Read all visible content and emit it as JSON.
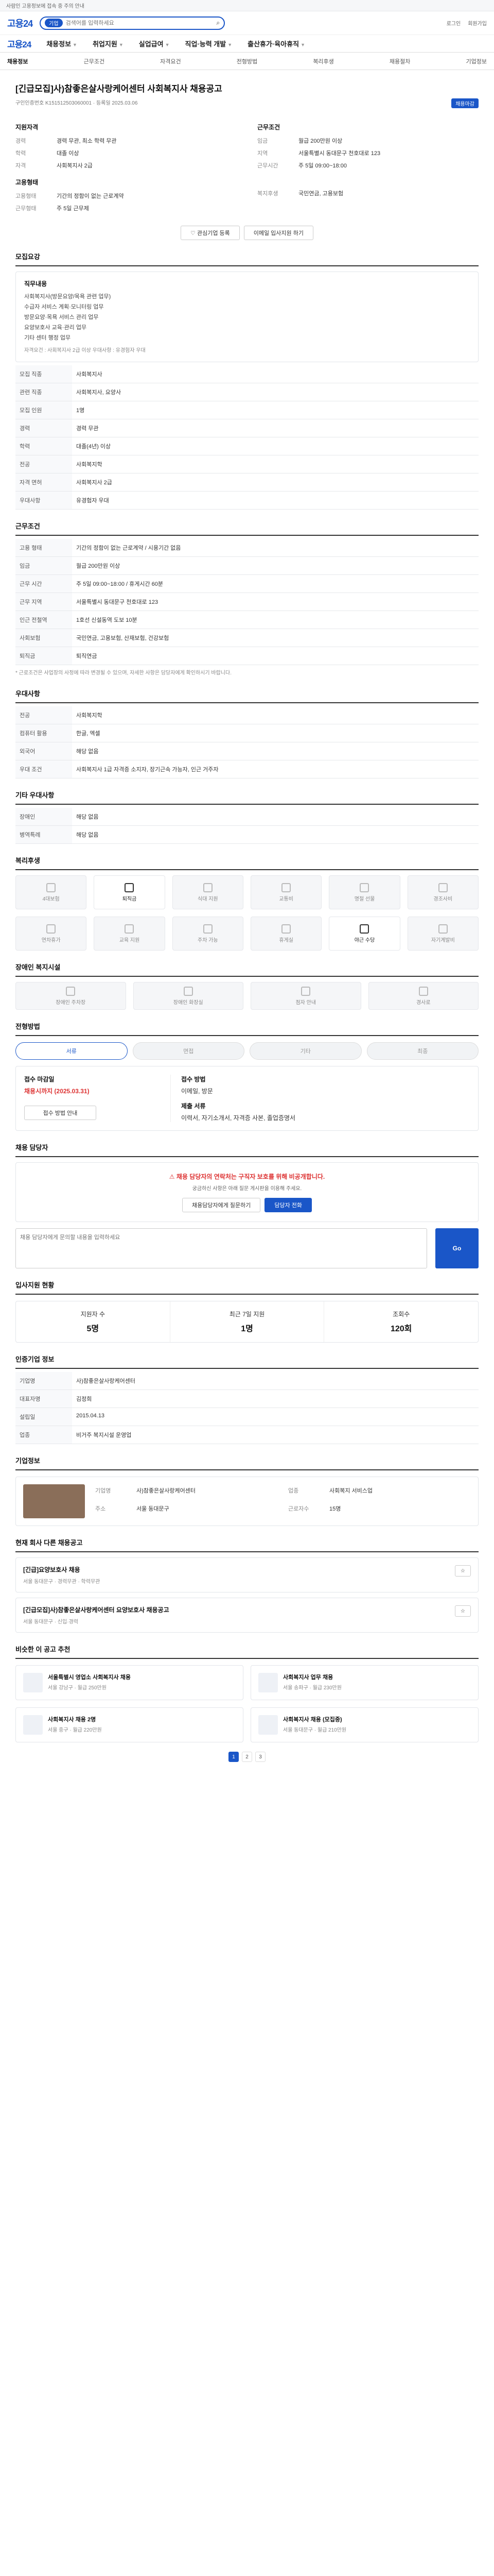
{
  "notice": "사람인 고용정보에 접속 중 주의 안내",
  "header": {
    "logo": "고용24",
    "search_placeholder": "검색어를 입력하세요",
    "search_chip": "기업",
    "login": "로그인",
    "join": "회원가입"
  },
  "gnb": {
    "items": [
      "채용정보",
      "취업지원",
      "실업급여",
      "직업·능력 개발",
      "출산휴가·육아휴직"
    ]
  },
  "tabs": [
    "채용정보",
    "근무조건",
    "자격요건",
    "전형방법",
    "복리후생",
    "채용절차",
    "기업정보"
  ],
  "job": {
    "title": "[긴급모집]사)참좋은살사랑케어센터 사회복지사 채용공고",
    "id": "구인인증번호 K151512503060001",
    "date": "등록일 2025.03.06",
    "status": "채용마감"
  },
  "summary": {
    "left_h": "지원자격",
    "left": [
      [
        "경력",
        "경력 무관, 최소 학력 무관"
      ],
      [
        "학력",
        "대졸 이상"
      ],
      [
        "자격",
        "사회복지사 2급"
      ]
    ],
    "right_h": "근무조건",
    "right": [
      [
        "임금",
        "월급 200만원 이상"
      ],
      [
        "지역",
        "서울특별시 동대문구 천호대로 123"
      ],
      [
        "근무시간",
        "주 5일 09:00~18:00"
      ]
    ],
    "bottom_h": "고용형태",
    "bottom": [
      [
        "고용형태",
        "기간의 정함이 없는 근로계약"
      ],
      [
        "근무형태",
        "주 5일 근무제"
      ]
    ],
    "bottom_r": [
      [
        "복지후생",
        "국민연금, 고용보험"
      ]
    ]
  },
  "btns": {
    "interest": "관심기업 등록",
    "apply": "이메일 입사지원 하기"
  },
  "jobinfo": {
    "title": "모집요강",
    "h": "직무내용",
    "items": [
      "사회복지사(방문요양/목욕 관련 업무)",
      "수급자 서비스 계획·모니터링 업무",
      "방문요양·목욕 서비스 관리 업무",
      "요양보호사 교육·관리 업무",
      "기타 센터 행정 업무"
    ],
    "note": "자격요건 : 사회복지사 2급 이상 우대사항 : 유경험자 우대"
  },
  "table1": [
    [
      "모집 직종",
      "사회복지사"
    ],
    [
      "관련 직종",
      "사회복지사, 요양사"
    ],
    [
      "모집 인원",
      "1명"
    ],
    [
      "경력",
      "경력 무관"
    ],
    [
      "학력",
      "대졸(4년) 이상"
    ],
    [
      "전공",
      "사회복지학"
    ],
    [
      "자격 면허",
      "사회복지사 2급"
    ],
    [
      "우대사항",
      "유경험자 우대"
    ]
  ],
  "work": {
    "title": "근무조건",
    "rows": [
      [
        "고용 형태",
        "기간의 정함이 없는 근로계약 / 시용기간 없음"
      ],
      [
        "임금",
        "월급 200만원 이상"
      ],
      [
        "근무 시간",
        "주 5일 09:00~18:00 / 휴게시간 60분"
      ],
      [
        "근무 지역",
        "서울특별시 동대문구 천호대로 123"
      ],
      [
        "인근 전철역",
        "1호선 신설동역 도보 10분"
      ],
      [
        "사회보험",
        "국민연금, 고용보험, 산재보험, 건강보험"
      ],
      [
        "퇴직금",
        "퇴직연금"
      ]
    ],
    "note": "* 근로조건은 사업장의 사정에 따라 변경될 수 있으며, 자세한 사항은 담당자에게 확인하시기 바랍니다."
  },
  "qual": {
    "title": "우대사항",
    "rows": [
      [
        "전공",
        "사회복지학"
      ],
      [
        "컴퓨터 활용",
        "한글, 엑셀"
      ],
      [
        "외국어",
        "해당 없음"
      ],
      [
        "우대 조건",
        "사회복지사 1급 자격증 소지자, 장기근속 가능자, 인근 거주자"
      ]
    ]
  },
  "other": {
    "title": "기타 우대사항",
    "rows": [
      [
        "장애인",
        "해당 없음"
      ],
      [
        "병역특례",
        "해당 없음"
      ]
    ]
  },
  "welfare": {
    "title": "복리후생",
    "tiles": [
      "4대보험",
      "퇴직금",
      "식대 지원",
      "교통비",
      "명절 선물",
      "경조사비",
      "연차휴가",
      "교육 지원",
      "주차 가능",
      "휴게실",
      "야근 수당",
      "자기계발비"
    ],
    "active": [
      1,
      10
    ]
  },
  "disab": {
    "title": "장애인 복지시설",
    "tiles": [
      "장애인 주차장",
      "장애인 화장실",
      "점자 안내",
      "경사로"
    ]
  },
  "apply": {
    "title": "전형방법",
    "steps": [
      "서류",
      "면접",
      "기타",
      "최종"
    ],
    "active": 1,
    "l_h": "접수 마감일",
    "l_v": "채용시까지 (2025.03.31)",
    "r_h": "접수 방법",
    "r_v": "이메일, 방문",
    "r2_h": "제출 서류",
    "r2_v": "이력서, 자기소개서, 자격증 사본, 졸업증명서",
    "btn": "접수 방법 안내"
  },
  "qna": {
    "title": "채용 담당자",
    "warn_h": "채용 담당자의 연락처는 구직자 보호를 위해 비공개합니다.",
    "warn_p": "궁금하신 사항은 아래 질문 게시판을 이용해 주세요.",
    "btn1": "채용담당자에게 질문하기",
    "btn2": "담당자 전화",
    "q_placeholder": "채용 담당자에게 문의할 내용을 입력하세요",
    "q_btn": "Go"
  },
  "stats": {
    "title": "입사지원 현황",
    "items": [
      [
        "지원자 수",
        "5명"
      ],
      [
        "최근 7일 지원",
        "1명"
      ],
      [
        "조회수",
        "120회"
      ]
    ]
  },
  "recruit": {
    "title": "인증기업 정보",
    "rows": [
      [
        "기업명",
        "사)참좋은살사랑케어센터"
      ],
      [
        "대표자명",
        "김정희"
      ],
      [
        "설립일",
        "2015.04.13"
      ],
      [
        "업종",
        "비거주 복지시설 운영업"
      ]
    ]
  },
  "company": {
    "title": "기업정보",
    "rows": [
      [
        "기업명",
        "사)참좋은살사랑케어센터"
      ],
      [
        "업종",
        "사회복지 서비스업"
      ],
      [
        "주소",
        "서울 동대문구"
      ],
      [
        "근로자수",
        "15명"
      ]
    ]
  },
  "others": {
    "title": "현재 회사 다른 채용공고",
    "items": [
      [
        "[긴급]요양보호사 채용",
        "서울 동대문구 · 경력무관 · 학력무관"
      ],
      [
        "[긴급모집]사)참좋은살사랑케어센터 요양보호사 채용공고",
        "서울 동대문구 · 신입·경력"
      ]
    ]
  },
  "recs": {
    "title": "비슷한 이 공고 추천",
    "cards": [
      [
        "서울특별시 영업소 사회복지사 채용",
        "서울 강남구 · 월급 250만원"
      ],
      [
        "사회복지사 업무 채용",
        "서울 송파구 · 월급 230만원"
      ],
      [
        "사회복지사 채용 2명",
        "서울 중구 · 월급 220만원"
      ],
      [
        "사회복지사 채용 (모집중)",
        "서울 동대문구 · 월급 210만원"
      ]
    ]
  },
  "pager": [
    "1",
    "2",
    "3"
  ]
}
